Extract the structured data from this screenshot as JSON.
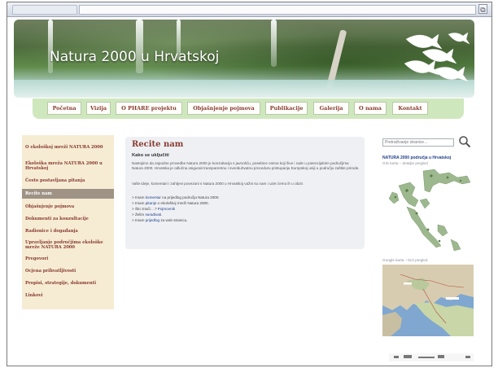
{
  "browser": {
    "corner_icon": "page-icon"
  },
  "banner": {
    "title": "Natura 2000 u Hrvatskoj"
  },
  "nav": {
    "items": [
      {
        "label": "Početna"
      },
      {
        "label": "Vizija"
      },
      {
        "label": "O PHARE projektu"
      },
      {
        "label": "Objašnjenje pojmova"
      },
      {
        "label": "Publikacije"
      },
      {
        "label": "Galerija"
      },
      {
        "label": "O nama"
      },
      {
        "label": "Kontakt"
      }
    ]
  },
  "sidebar": {
    "items": [
      {
        "label": "O ekološkoj mreži NATURA 2000"
      },
      {
        "label": "Ekološka mreža NATURA 2000 u Hrvatskoj"
      },
      {
        "label": "Često postavljana pitanja"
      },
      {
        "label": "Recite nam",
        "active": true
      },
      {
        "label": "Objašnjenje pojmova"
      },
      {
        "label": "Dokumenti za konzultacije"
      },
      {
        "label": "Radionice i događanja"
      },
      {
        "label": "Upravljanje područjima ekološke mreže NATURA 2000"
      },
      {
        "label": "Pregovori"
      },
      {
        "label": "Ocjena prihvatljivosti"
      },
      {
        "label": "Propisi, strategije, dokumenti"
      },
      {
        "label": "Linkovi"
      }
    ]
  },
  "main": {
    "title": "Recite nam",
    "subtitle": "Kako se uključiti",
    "paragraph1": "Nastojimo da zapodne provedbe Natura 2000 je konzultacija s javnošću, posebice onima koji žive i rade u potencijalnim područjima Natura 2000. Hrvatska je odlučna osigurati transparentnu i sveobuhvatnu proceduru pristupanju Europskoj uniji u području zaštite prirode.",
    "paragraph2": "Vaše ideje, komentari i zahtjevi povezani s Natura 2000 u Hrvatskoj važni su nam i uzet ćemo ih u obzir.",
    "lines": [
      {
        "pre": "> Imam ",
        "link": "komentar",
        "post": " na prijedlog područja Natura 2000."
      },
      {
        "pre": "> Imam ",
        "link": "pitanje",
        "post": " o ekološkoj mreži Natura 2000."
      },
      {
        "pre": "> Što znači ...? ",
        "link": "Pojmovnik",
        "post": ""
      },
      {
        "pre": "> Želim ",
        "link": "surađivati",
        "post": "."
      },
      {
        "pre": "> Imam ",
        "link": "prijedlog",
        "post": " za web stranicu."
      }
    ]
  },
  "right": {
    "search_placeholder": "Pretraživanje stranice...",
    "search_icon": "magnifier-icon",
    "map_title": "NATURA 2000 područja u Hrvatskoj",
    "map_link": "GIS karta – detaljni pregled",
    "map2_link": "Google karta – brzi pregled"
  },
  "colors": {
    "accent": "#8a3b30",
    "link": "#1f3e8a",
    "nav_bar": "#cfe7bd",
    "sidebar_bg": "#f6ecd4",
    "sidebar_active": "#9e9385"
  }
}
